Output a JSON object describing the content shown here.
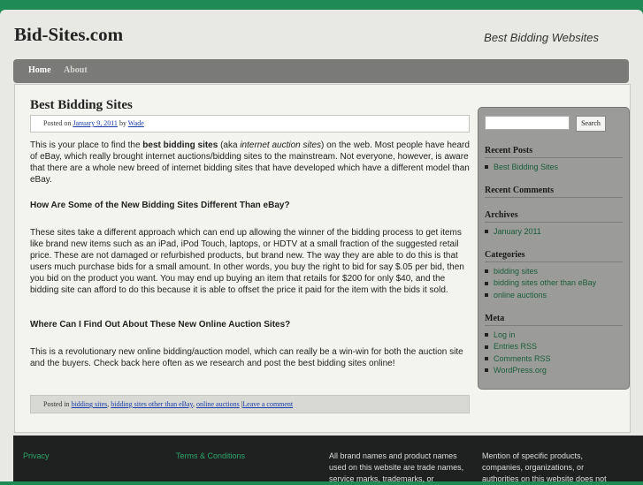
{
  "site": {
    "title": "Bid-Sites.com",
    "tagline": "Best Bidding Websites"
  },
  "nav": {
    "items": [
      "Home",
      "About"
    ]
  },
  "post": {
    "title": "Best Bidding Sites",
    "meta_prefix": "Posted on",
    "meta_date": "January 9, 2011",
    "meta_by": "by",
    "meta_author": "Wade",
    "p1_a": "This is your place to find the ",
    "p1_b": "best bidding sites",
    "p1_c": " (aka ",
    "p1_d": "internet auction sites",
    "p1_e": ") on the web.  Most people have heard of eBay, which really brought internet auctions/bidding sites to the mainstream.  Not everyone, however, is aware that there are a whole new breed of internet bidding sites that have developed which have a different model than eBay.",
    "h1": "How Are Some of the New Bidding Sites Different Than eBay?",
    "p2": "These sites take a different approach which can end up allowing the winner of the bidding process to get items like brand new items such as an iPad, iPod Touch, laptops,  or HDTV at a small fraction of the suggested retail price.  These are not damaged or refurbished products, but brand new.  The way they are able to do this is that users much purchase bids for a small amount.  In other words, you buy the right to bid for say $.05 per bid, then you bid on the product you want.  You may end up buying an item that retails for $200 for only $40, and the bidding site can afford to do this because it is able to offset the price it paid for the item with the bids it sold.",
    "h2": "Where Can I Find Out About These New Online Auction Sites?",
    "p3": "This is a revolutionary new online bidding/auction model, which can really be a win-win for both the auction site and the buyers.  Check back here often as we research and post the best bidding sites online!",
    "footer_prefix": "Posted in",
    "cat1": "bidding sites",
    "cat2": "bidding sites other than eBay",
    "cat3": "online auctions",
    "sep": ",",
    "pipe": "|",
    "comment": "Leave a comment"
  },
  "sidebar": {
    "search_button": "Search",
    "search_value": "",
    "recent_posts_title": "Recent Posts",
    "recent_posts": [
      "Best Bidding Sites"
    ],
    "recent_comments_title": "Recent Comments",
    "archives_title": "Archives",
    "archives": [
      "January 2011"
    ],
    "categories_title": "Categories",
    "categories": [
      "bidding sites",
      "bidding sites other than eBay",
      "online auctions"
    ],
    "meta_title": "Meta",
    "meta": [
      "Log in",
      "Entries RSS",
      "Comments RSS",
      "WordPress.org"
    ]
  },
  "footer": {
    "privacy": "Privacy",
    "terms": "Terms & Conditions",
    "col3": "All brand names and product names used on this website are trade names, service marks, trademarks, or",
    "col4": "Mention of specific products, companies, organizations, or authorities on this website does not"
  },
  "colors": {
    "accent": "#1f8a55",
    "nav": "#7a7b78",
    "sidebar": "#9b9c99",
    "link": "#1a5c3a"
  }
}
